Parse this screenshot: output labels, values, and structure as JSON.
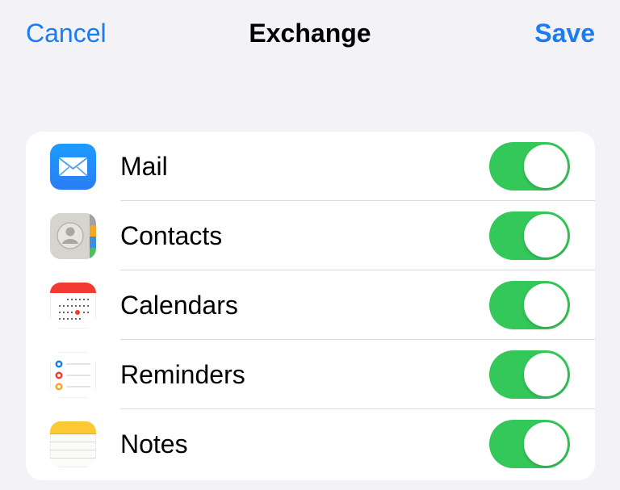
{
  "nav": {
    "cancel_label": "Cancel",
    "title": "Exchange",
    "save_label": "Save"
  },
  "accent_color": "#1a7cf2",
  "toggle_on_color": "#34c759",
  "items": [
    {
      "label": "Mail",
      "icon": "mail-icon",
      "enabled": true
    },
    {
      "label": "Contacts",
      "icon": "contacts-icon",
      "enabled": true
    },
    {
      "label": "Calendars",
      "icon": "calendar-icon",
      "enabled": true
    },
    {
      "label": "Reminders",
      "icon": "reminders-icon",
      "enabled": true
    },
    {
      "label": "Notes",
      "icon": "notes-icon",
      "enabled": true
    }
  ]
}
